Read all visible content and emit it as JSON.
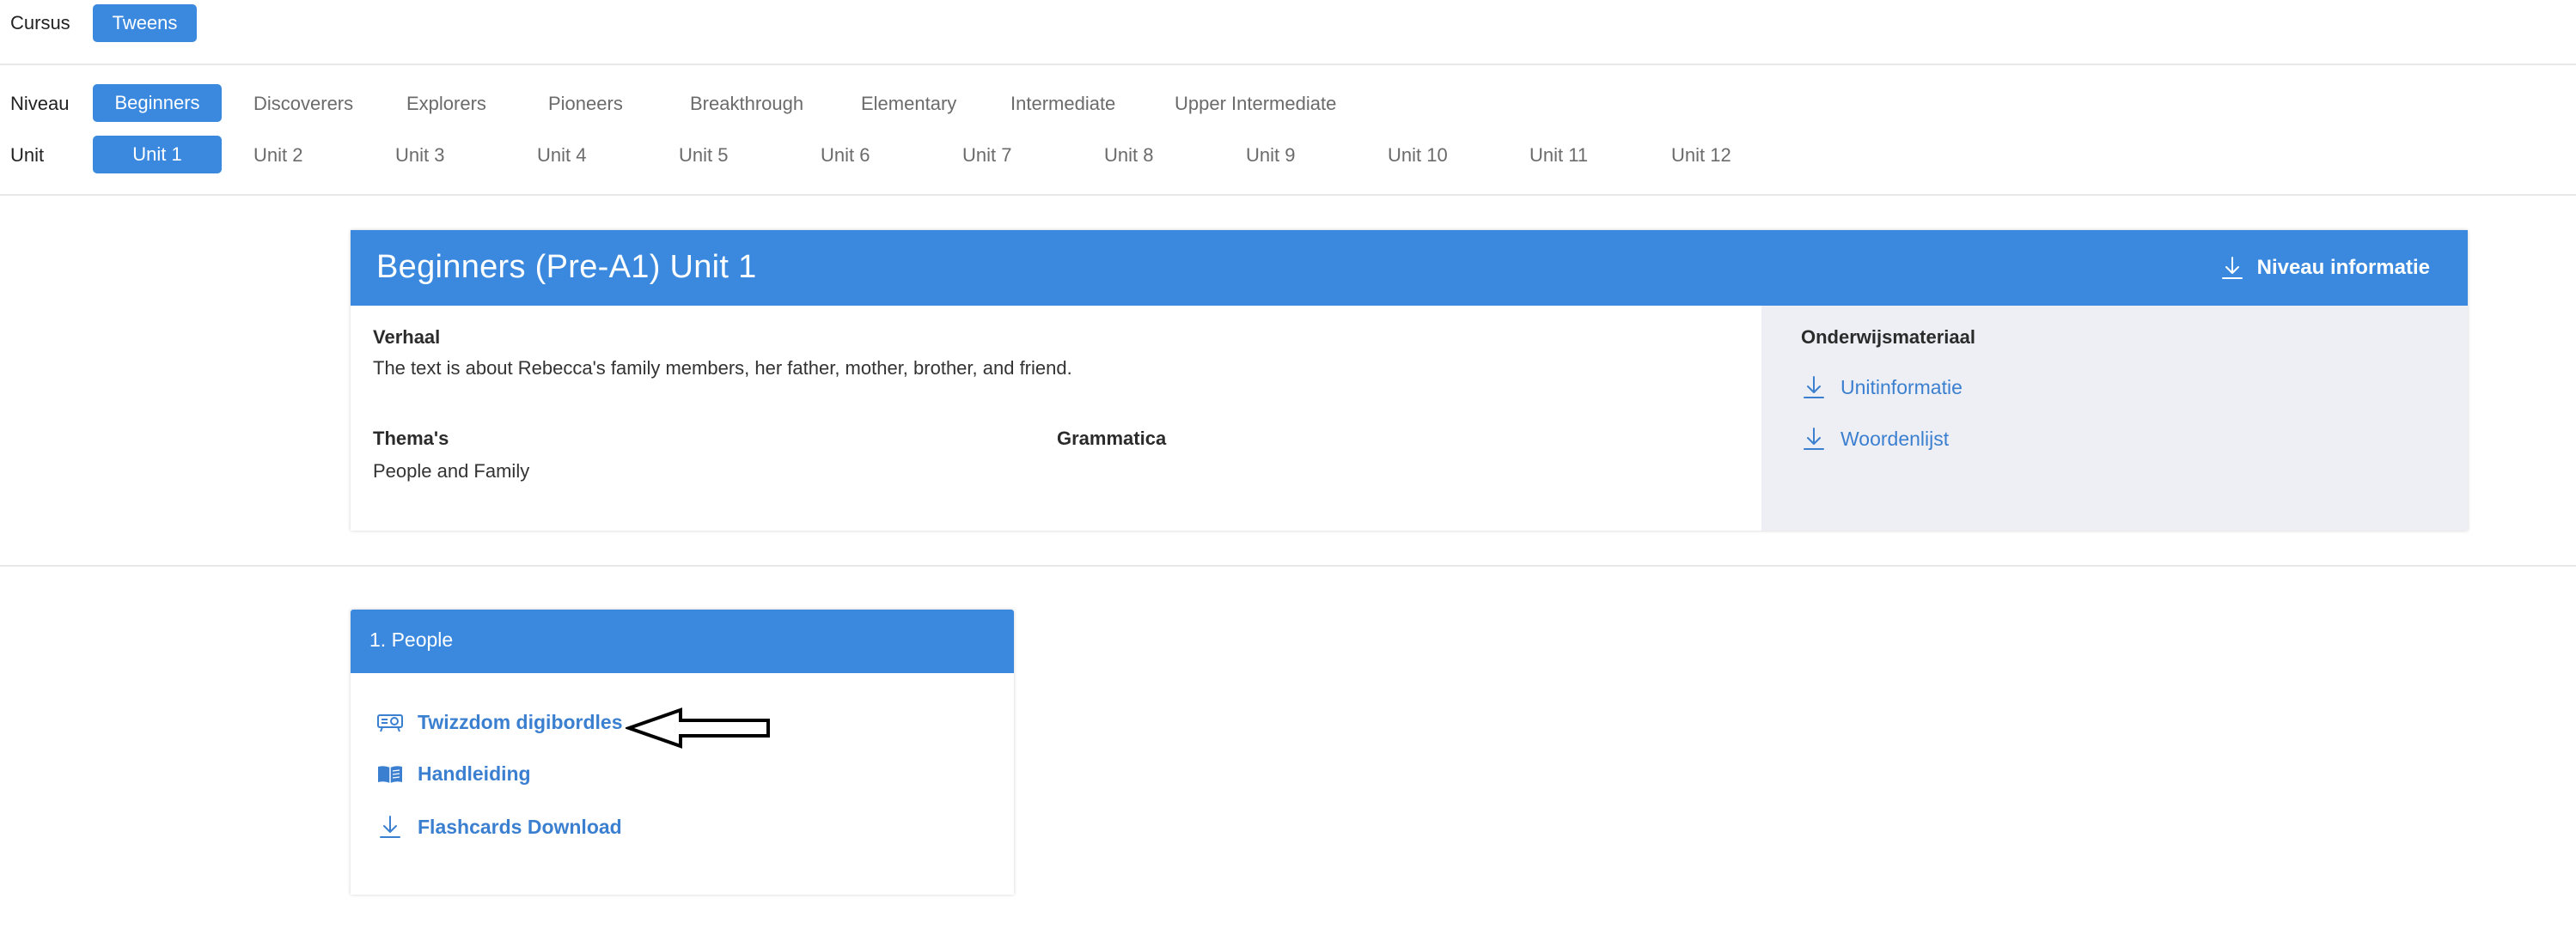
{
  "cursus": {
    "label": "Cursus",
    "selected": "Tweens"
  },
  "niveau": {
    "label": "Niveau",
    "options": [
      "Beginners",
      "Discoverers",
      "Explorers",
      "Pioneers",
      "Breakthrough",
      "Elementary",
      "Intermediate",
      "Upper Intermediate"
    ],
    "selected": "Beginners"
  },
  "unit": {
    "label": "Unit",
    "options": [
      "Unit 1",
      "Unit 2",
      "Unit 3",
      "Unit 4",
      "Unit 5",
      "Unit 6",
      "Unit 7",
      "Unit 8",
      "Unit 9",
      "Unit 10",
      "Unit 11",
      "Unit 12"
    ],
    "selected": "Unit 1"
  },
  "unit_card": {
    "title": "Beginners (Pre-A1) Unit 1",
    "niveau_button": "Niveau informatie",
    "verhaal_label": "Verhaal",
    "verhaal_text": "The text is about Rebecca's family members, her father, mother, brother, and friend.",
    "themas_label": "Thema's",
    "themas_text": "People and Family",
    "grammatica_label": "Grammatica",
    "materials_label": "Onderwijsmateriaal",
    "materials": [
      "Unitinformatie",
      "Woordenlijst"
    ]
  },
  "lesson": {
    "title": "1. People",
    "links": [
      {
        "label": "Twizzdom digibordles",
        "icon": "projector-icon"
      },
      {
        "label": "Handleiding",
        "icon": "book-icon"
      },
      {
        "label": "Flashcards Download",
        "icon": "download-icon"
      }
    ]
  },
  "colors": {
    "accent": "#3b89df",
    "link": "#3b7fd0",
    "panel": "#eeeff4"
  }
}
